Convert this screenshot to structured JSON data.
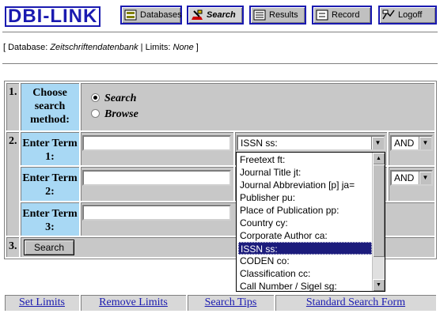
{
  "header": {
    "logo": "DBI-LINK",
    "buttons": [
      {
        "label": "Databases",
        "icon": "database-icon"
      },
      {
        "label": "Search",
        "icon": "search-icon"
      },
      {
        "label": "Results",
        "icon": "results-icon"
      },
      {
        "label": "Record",
        "icon": "record-icon"
      },
      {
        "label": "Logoff",
        "icon": "logoff-icon"
      }
    ]
  },
  "info": {
    "db_prefix": "[ Database: ",
    "db_name": "Zeitschriftendatenbank",
    "limits_prefix": " | Limits: ",
    "limits_value": "None",
    "suffix": " ]"
  },
  "form": {
    "rows": [
      {
        "num": "1.",
        "label": "Choose search method:"
      },
      {
        "num": "2.",
        "label": "Enter Term 1:"
      },
      {
        "num": "",
        "label": "Enter Term 2:"
      },
      {
        "num": "",
        "label": "Enter Term 3:"
      },
      {
        "num": "3.",
        "label": ""
      }
    ],
    "method": {
      "option1": "Search",
      "option2": "Browse",
      "selected": "Search"
    },
    "term1": {
      "value": "",
      "field": "ISSN ss:",
      "operator": "AND"
    },
    "term2": {
      "value": "",
      "operator": "AND"
    },
    "term3": {
      "value": ""
    },
    "search_button": "Search"
  },
  "dropdown": {
    "options": [
      "Freetext ft:",
      "Journal Title jt:",
      "Journal Abbreviation [p] ja=",
      "Publisher pu:",
      "Place of Publication pp:",
      "Country cy:",
      "Corporate Author ca:",
      "ISSN ss:",
      "CODEN co:",
      "Classification cc:",
      "Call Number / Sigel sg:"
    ],
    "selected": "ISSN ss:"
  },
  "footer": {
    "links": [
      "Set Limits",
      "Remove Limits",
      "Search Tips",
      "Standard Search Form"
    ]
  },
  "colors": {
    "accent": "#1a1ab0",
    "label_bg": "#a8d8f4",
    "selected_bg": "#1c1c7c"
  }
}
